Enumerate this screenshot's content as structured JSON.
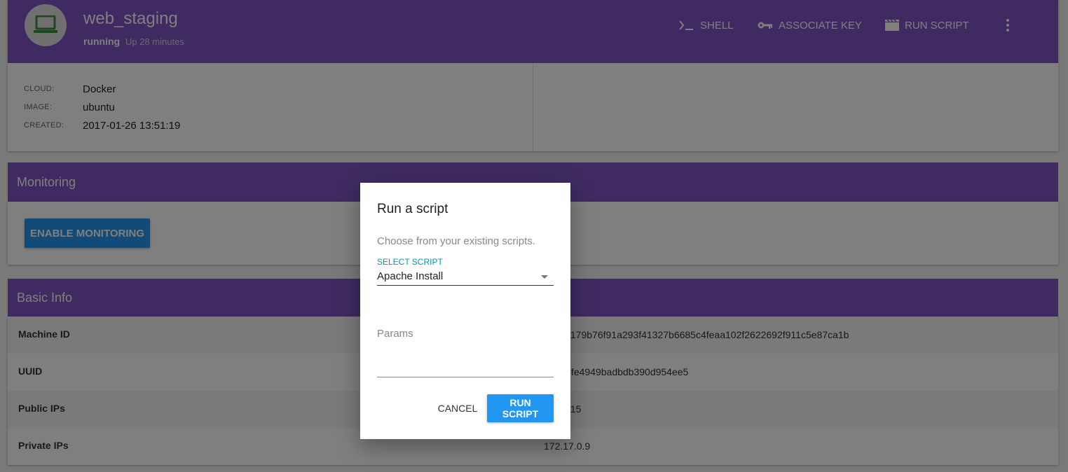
{
  "header": {
    "machine_name": "web_staging",
    "status": "running",
    "uptime": "Up 28 minutes",
    "actions": {
      "shell": "SHELL",
      "associate_key": "ASSOCIATE KEY",
      "run_script": "RUN SCRIPT"
    },
    "avatar_icon": "laptop-icon",
    "accent_color": "#7e57c2"
  },
  "info": {
    "cloud_label": "CLOUD:",
    "cloud_value": "Docker",
    "image_label": "IMAGE:",
    "image_value": "ubuntu",
    "created_label": "CREATED:",
    "created_value": "2017-01-26 13:51:19"
  },
  "monitoring": {
    "title": "Monitoring",
    "enable_button": "ENABLE MONITORING"
  },
  "basic_info": {
    "title": "Basic Info",
    "rows": [
      {
        "label": "Machine ID",
        "value": "e39e1179b76f91a293f41327b6685c4feaa102f2622692f911c5e87ca1b"
      },
      {
        "label": "UUID",
        "value": "97d05fe4949badbdb390d954ee5"
      },
      {
        "label": "Public IPs",
        "value": "1.30.115"
      },
      {
        "label": "Private IPs",
        "value": "172.17.0.9"
      }
    ]
  },
  "dialog": {
    "title": "Run a script",
    "description": "Choose from your existing scripts.",
    "select_label": "SELECT SCRIPT",
    "selected_script": "Apache Install",
    "params_label": "Params",
    "cancel_button": "CANCEL",
    "run_button": "RUN SCRIPT",
    "primary_color": "#2196f3"
  }
}
